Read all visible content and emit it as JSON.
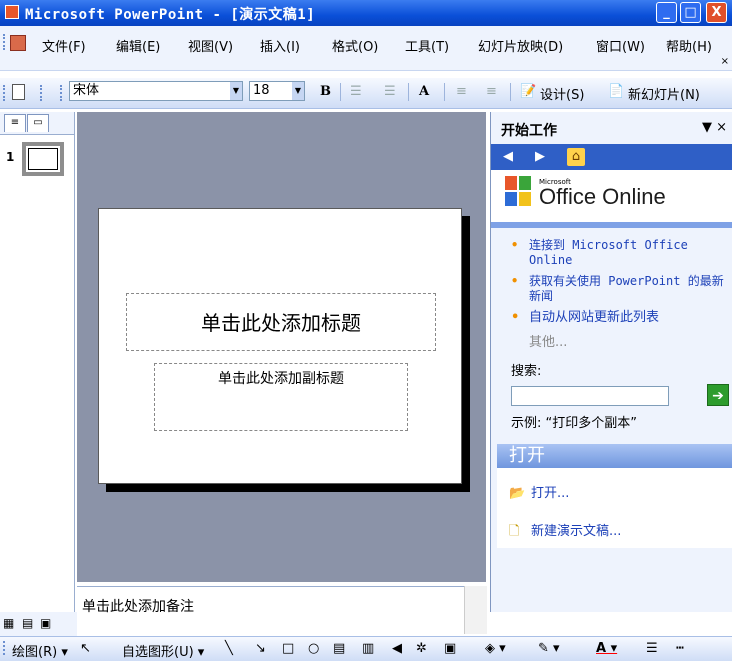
{
  "window": {
    "title": "Microsoft PowerPoint - [演示文稿1]",
    "min_glyph": "_",
    "max_glyph": "□",
    "close_glyph": "X"
  },
  "menu": {
    "items": [
      "文件(F)",
      "编辑(E)",
      "视图(V)",
      "插入(I)",
      "格式(O)",
      "工具(T)",
      "幻灯片放映(D)",
      "窗口(W)",
      "帮助(H)"
    ],
    "doc_close": "×"
  },
  "toolbar": {
    "font": "宋体",
    "size": "18",
    "bold": "B",
    "grow_font": "A",
    "design": "设计(S)",
    "new_slide": "新幻灯片(N)"
  },
  "slides_pane": {
    "slide_number": "1"
  },
  "slide": {
    "title_placeholder": "单击此处添加标题",
    "subtitle_placeholder": "单击此处添加副标题"
  },
  "notes": {
    "placeholder": "单击此处添加备注"
  },
  "task_pane": {
    "title": "开始工作",
    "close": "×",
    "logo_small": "Microsoft",
    "logo_text": "Office Online",
    "links": [
      "连接到 Microsoft Office Online",
      "获取有关使用 PowerPoint 的最新新闻",
      "自动从网站更新此列表"
    ],
    "more": "其他...",
    "search_label": "搜索:",
    "search_value": "",
    "example": "示例:  “打印多个副本”",
    "open_header": "打开",
    "open_link": "打开...",
    "new_presentation": "新建演示文稿..."
  },
  "drawing_toolbar": {
    "draw": "绘图(R)",
    "autoshapes": "自选图形(U)"
  }
}
